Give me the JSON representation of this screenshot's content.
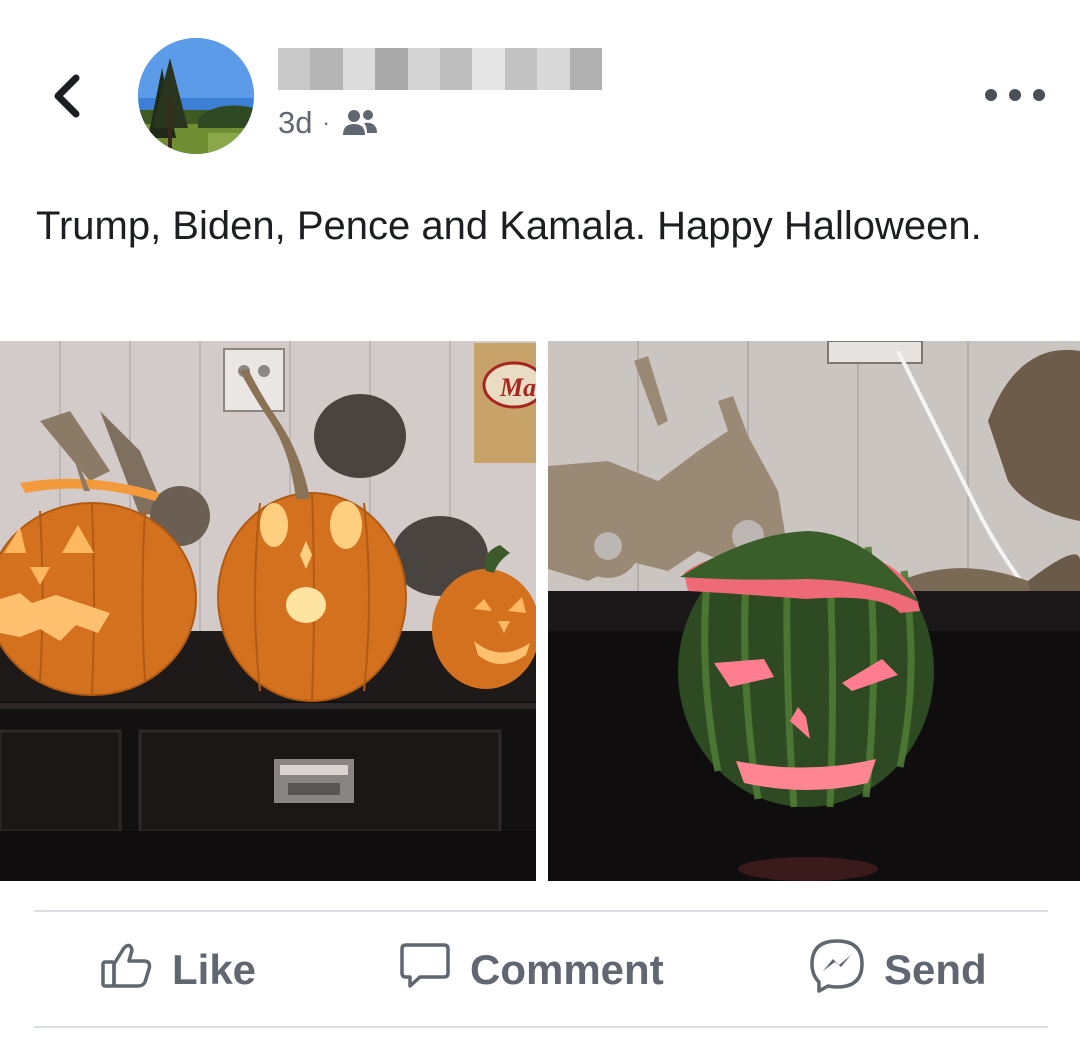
{
  "post": {
    "time": "3d",
    "separator": "·",
    "audience_icon": "friends-icon",
    "text": "Trump, Biden, Pence and Kamala.  Happy Halloween."
  },
  "photos": [
    {
      "name": "pumpkins-photo",
      "sign_text": "Ma"
    },
    {
      "name": "watermelon-photo"
    }
  ],
  "actions": {
    "like": "Like",
    "comment": "Comment",
    "send": "Send"
  },
  "colors": {
    "text": "#1c1e21",
    "secondary": "#606770",
    "divider": "#dadde1"
  }
}
